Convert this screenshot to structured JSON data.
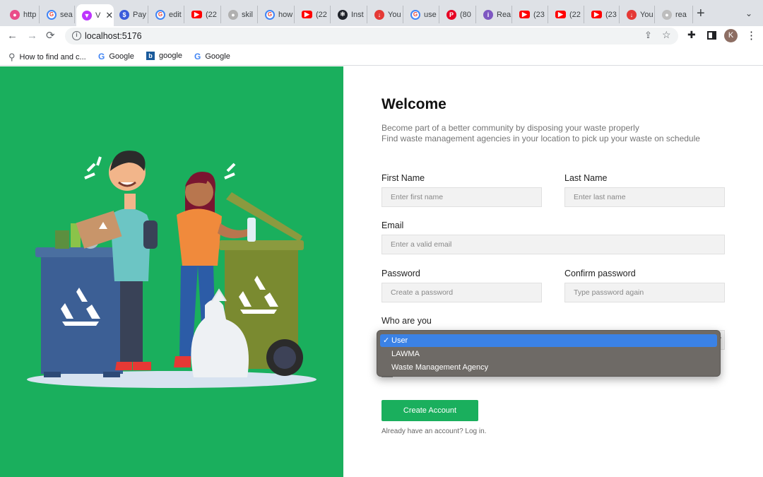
{
  "browser": {
    "tabs": [
      {
        "label": "http",
        "icon": "dribbble-icon",
        "color": "#ea4c89"
      },
      {
        "label": "sea",
        "icon": "google-icon",
        "color": "#4285f4"
      },
      {
        "label": "V",
        "icon": "vite-icon",
        "color": "#bd34fe",
        "active": true
      },
      {
        "label": "Pay",
        "icon": "payment-icon",
        "color": "#3b5bdb"
      },
      {
        "label": "edit",
        "icon": "google-icon",
        "color": "#4285f4"
      },
      {
        "label": "(22",
        "icon": "youtube-icon",
        "color": "#ff0000"
      },
      {
        "label": "skil",
        "icon": "github-icon",
        "color": "#b0b0b0"
      },
      {
        "label": "how",
        "icon": "google-icon",
        "color": "#4285f4"
      },
      {
        "label": "(22",
        "icon": "youtube-icon",
        "color": "#ff0000"
      },
      {
        "label": "Inst",
        "icon": "react-icon",
        "color": "#20232a"
      },
      {
        "label": "You",
        "icon": "download-icon",
        "color": "#e53935"
      },
      {
        "label": "use",
        "icon": "google-icon",
        "color": "#4285f4"
      },
      {
        "label": "(80",
        "icon": "pinterest-icon",
        "color": "#e60023"
      },
      {
        "label": "Rea",
        "icon": "info-icon",
        "color": "#7e57c2"
      },
      {
        "label": "(23",
        "icon": "youtube-icon",
        "color": "#ff0000"
      },
      {
        "label": "(22",
        "icon": "youtube-icon",
        "color": "#ff0000"
      },
      {
        "label": "(23",
        "icon": "youtube-icon",
        "color": "#ff0000"
      },
      {
        "label": "You",
        "icon": "download-icon",
        "color": "#e53935"
      },
      {
        "label": "rea",
        "icon": "globe-icon",
        "color": "#bdbdbd"
      }
    ],
    "url": "localhost:5176",
    "avatar_letter": "K",
    "bookmarks": [
      {
        "label": "How to find and c...",
        "icon": "search-icon"
      },
      {
        "label": "Google",
        "icon": "google-icon"
      },
      {
        "label": "google",
        "icon": "bing-icon"
      },
      {
        "label": "Google",
        "icon": "google-icon"
      }
    ]
  },
  "form": {
    "title": "Welcome",
    "subtitle_line1": "Become part of a better community by disposing your waste properly",
    "subtitle_line2": "Find waste management agencies in your location to pick up your waste on schedule",
    "first_name_label": "First Name",
    "first_name_placeholder": "Enter first name",
    "last_name_label": "Last Name",
    "last_name_placeholder": "Enter last name",
    "email_label": "Email",
    "email_placeholder": "Enter a valid email",
    "password_label": "Password",
    "password_placeholder": "Create a password",
    "confirm_label": "Confirm password",
    "confirm_placeholder": "Type password again",
    "role_label": "Who are you",
    "role_options": [
      "User",
      "LAWMA",
      "Waste Management Agency"
    ],
    "role_selected": "User",
    "check_mark": "✓",
    "create_button": "Create Account",
    "login_note": "Already have an account? Log in."
  },
  "colors": {
    "brand_green": "#1aaf5d",
    "dropdown_highlight": "#3b82e6"
  }
}
